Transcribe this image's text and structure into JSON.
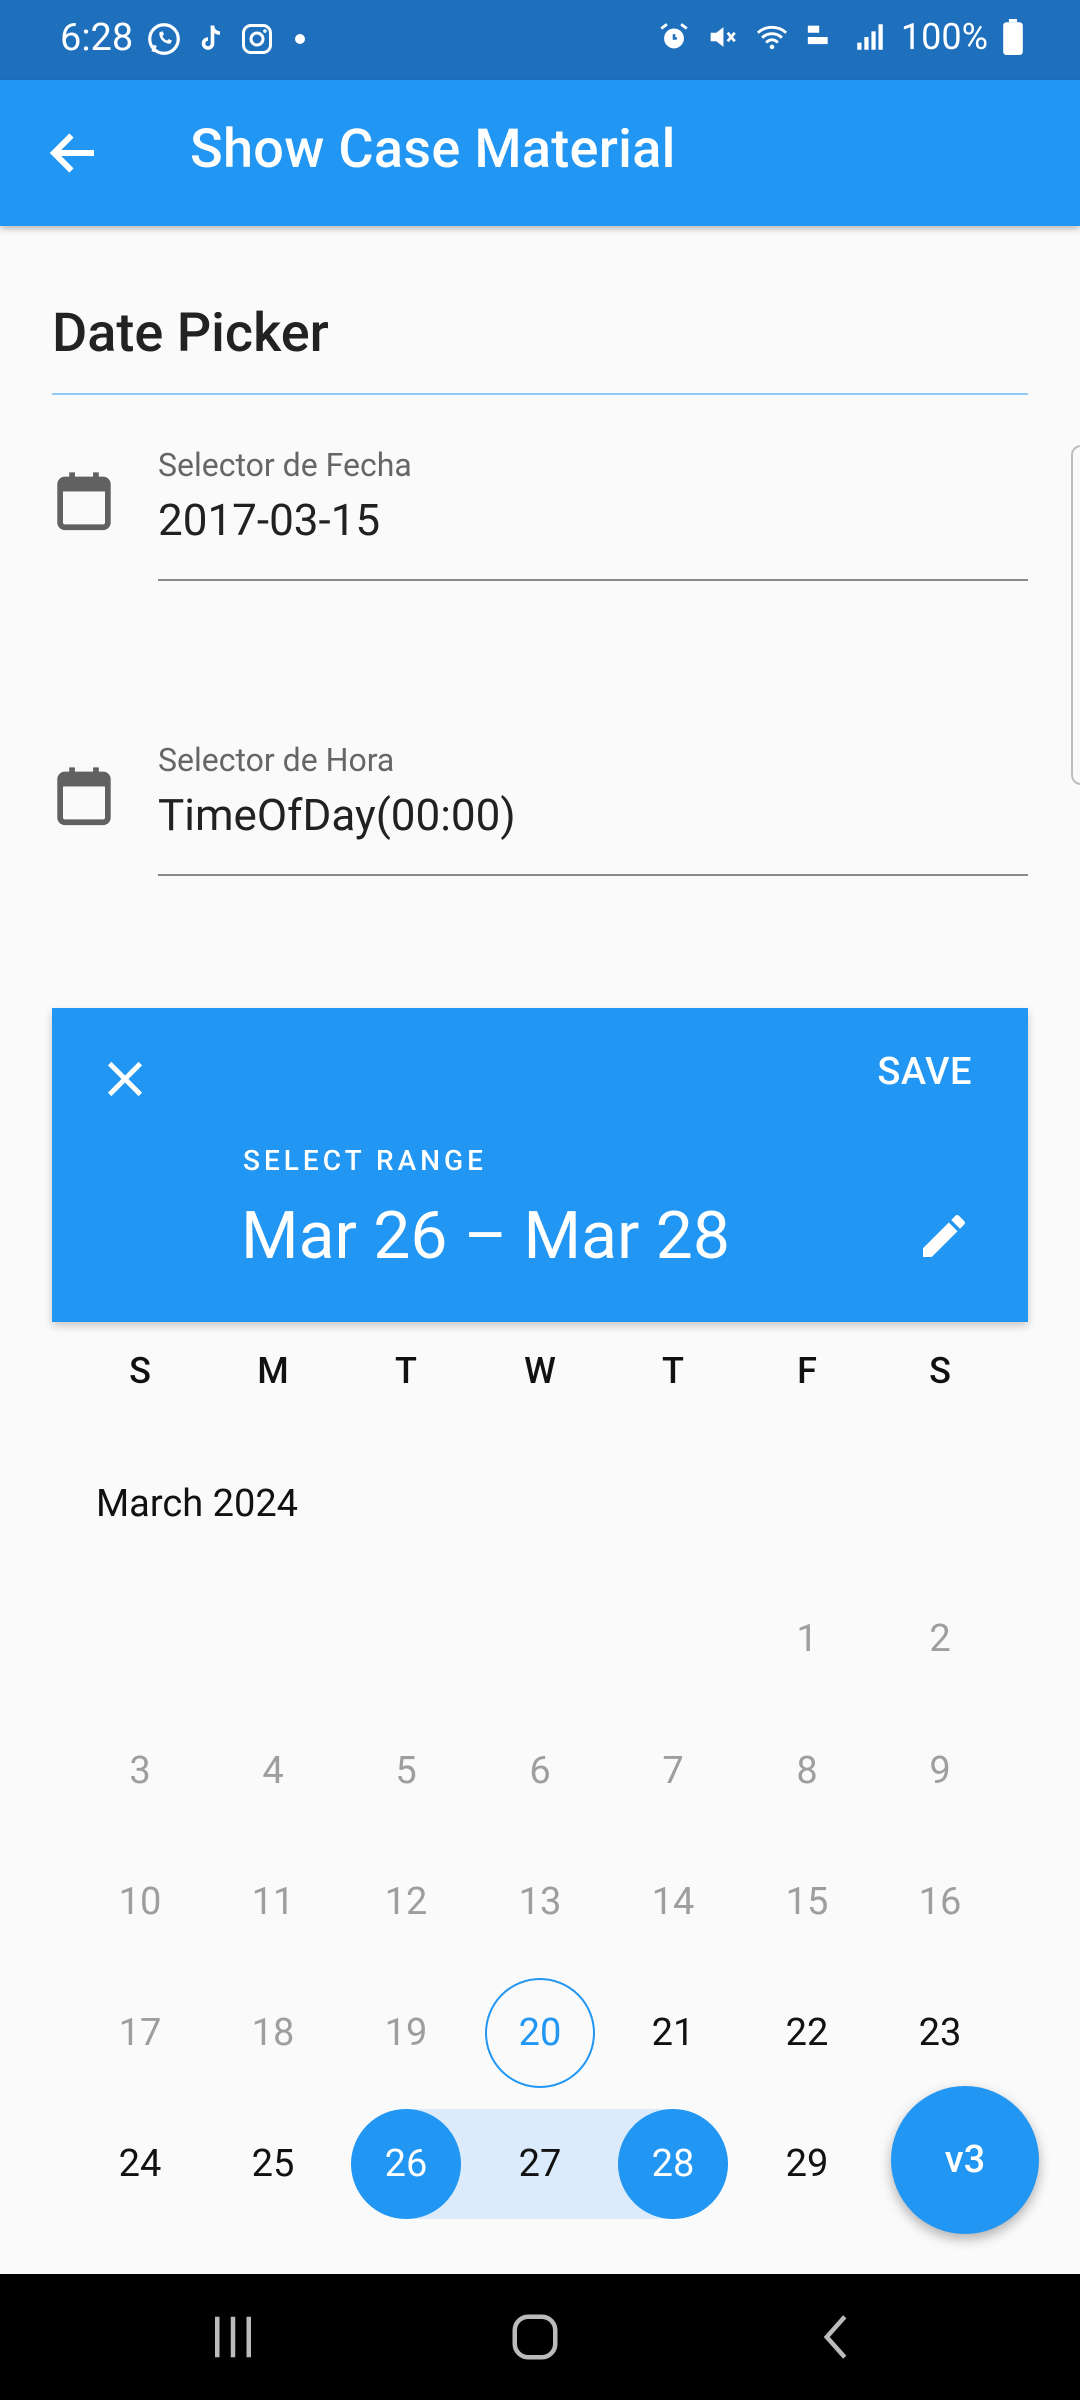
{
  "status_bar": {
    "time": "6:28",
    "battery": "100%",
    "notification_icons": [
      "whatsapp-icon",
      "tiktok-icon",
      "instagram-icon",
      "dot-icon"
    ],
    "system_icons": [
      "alarm-icon",
      "mute-icon",
      "wifi-icon",
      "volte-icon",
      "signal-icon",
      "battery-icon"
    ]
  },
  "app_bar": {
    "title": "Show Case Material"
  },
  "section": {
    "title": "Date Picker"
  },
  "fields": {
    "date": {
      "label": "Selector de Fecha",
      "value": "2017-03-15",
      "icon": "calendar-icon"
    },
    "time": {
      "label": "Selector de Hora",
      "value": "TimeOfDay(00:00)",
      "icon": "calendar-icon"
    }
  },
  "range_picker": {
    "save_label": "SAVE",
    "select_label": "SELECT RANGE",
    "range_text": "Mar 26 – Mar 28",
    "weekdays": [
      "S",
      "M",
      "T",
      "W",
      "T",
      "F",
      "S"
    ],
    "month": "March 2024",
    "days": [
      "1",
      "2",
      "3",
      "4",
      "5",
      "6",
      "7",
      "8",
      "9",
      "10",
      "11",
      "12",
      "13",
      "14",
      "15",
      "16",
      "17",
      "18",
      "19",
      "20",
      "21",
      "22",
      "23",
      "24",
      "25",
      "26",
      "27",
      "28",
      "29"
    ],
    "today": "20",
    "selected_start": "26",
    "selected_end": "28"
  },
  "fab": {
    "label": "v3"
  },
  "colors": {
    "primary": "#2196f3",
    "status_bar": "#1e70bd",
    "range_band": "#dcebfb"
  }
}
